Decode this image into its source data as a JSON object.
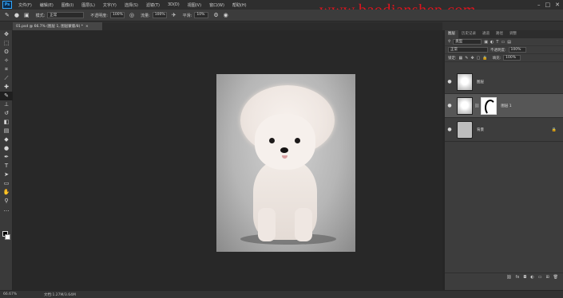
{
  "app": {
    "logo": "Ps",
    "menu": [
      "文件(F)",
      "编辑(E)",
      "图像(I)",
      "图层(L)",
      "文字(Y)",
      "选择(S)",
      "滤镜(T)",
      "3D(D)",
      "视图(V)",
      "窗口(W)",
      "帮助(H)"
    ],
    "watermark": "www.baodianshep.com",
    "window_controls": [
      "–",
      "□",
      "✕"
    ]
  },
  "options": {
    "mode_label": "模式:",
    "mode_value": "正常",
    "opacity_label": "不透明度:",
    "opacity_value": "100%",
    "flow_label": "流量:",
    "flow_value": "100%",
    "smooth_label": "平滑:",
    "smooth_value": "10%"
  },
  "document": {
    "tab_title": "01.psd @ 66.7% (图层 1, 图层蒙版/8) *",
    "tab_close": "×"
  },
  "status": {
    "zoom": "66.67%",
    "doc_size": "文档:1.27M/3.64M"
  },
  "layers_panel": {
    "tabs": [
      "图层",
      "历史记录",
      "通道",
      "路径",
      "调整"
    ],
    "filter_label": "类型",
    "blend_mode": "正常",
    "opacity_label": "不透明度:",
    "opacity_value": "100%",
    "lock_label": "锁定:",
    "fill_label": "填充:",
    "fill_value": "100%",
    "layers": [
      {
        "name": "图层",
        "eye": "●"
      },
      {
        "name": "图层 1",
        "eye": "●"
      },
      {
        "name": "背景",
        "eye": "●"
      }
    ],
    "footer_icons": [
      "link-icon",
      "fx-icon",
      "mask-icon",
      "adjust-icon",
      "group-icon",
      "new-layer-icon",
      "trash-icon"
    ]
  },
  "colors": {
    "accent": "#31a8ff",
    "watermark": "#e0141e",
    "panel_bg": "#3d3d3d",
    "canvas_bg": "#282828"
  }
}
